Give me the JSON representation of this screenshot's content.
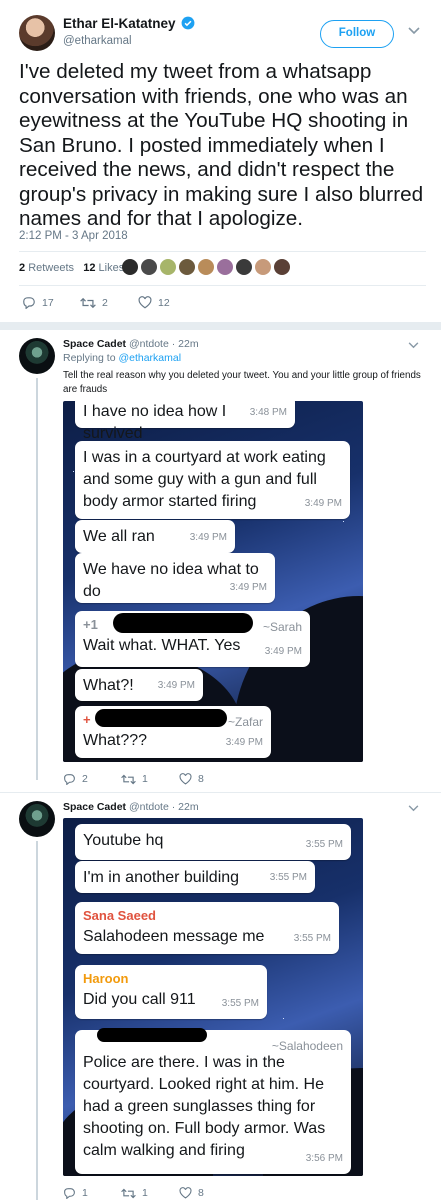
{
  "main_tweet": {
    "author_name": "Ethar El-Katatney",
    "author_handle": "@etharkamal",
    "follow_label": "Follow",
    "text": "I've deleted my tweet from a whatsapp conversation with friends, one who was an eyewitness at the YouTube HQ shooting in San Bruno. I posted immediately when I received the news, and didn't respect the group's privacy in making sure I also blurred names and for that I apologize.",
    "timestamp": "2:12 PM - 3 Apr 2018",
    "retweets_count": "2",
    "retweets_label": "Retweets",
    "likes_count": "12",
    "likes_label": "Likes",
    "replies": "17",
    "retweets": "2",
    "likes": "12"
  },
  "reply1": {
    "name": "Space Cadet",
    "handle_time": "@ntdote · 22m",
    "replying_prefix": "Replying to",
    "replying_to": "@etharkamal",
    "text": "Tell the real reason why you deleted your tweet. You and your little group of friends are frauds",
    "replies": "2",
    "retweets": "1",
    "likes": "8",
    "messages": [
      {
        "text": "I have no idea how I survived",
        "time": "3:48 PM"
      },
      {
        "text": "I was in a courtyard at work eating and some guy with a gun and full body armor started firing",
        "time": "3:49 PM"
      },
      {
        "text": "We all ran",
        "time": "3:49 PM"
      },
      {
        "text": "We have no idea what to do",
        "time": "3:49 PM"
      },
      {
        "sender_prefix": "+1",
        "nick": "~Sarah",
        "text": "Wait what. WHAT. Yes",
        "time": "3:49 PM"
      },
      {
        "text": "What?!",
        "time": "3:49 PM"
      },
      {
        "sender_prefix": "+",
        "nick": "~Zafar",
        "text": "What???",
        "time": "3:49 PM"
      }
    ]
  },
  "reply2": {
    "name": "Space Cadet",
    "handle_time": "@ntdote · 22m",
    "replies": "1",
    "retweets": "1",
    "likes": "8",
    "messages": [
      {
        "text": "Youtube hq",
        "time": "3:55 PM"
      },
      {
        "text": "I'm in another building",
        "time": "3:55 PM"
      },
      {
        "sender": "Sana Saeed",
        "sender_color": "#e0533f",
        "text": "Salahodeen message me",
        "time": "3:55 PM"
      },
      {
        "sender": "Haroon",
        "sender_color": "#f29a0c",
        "text": "Did you call 911",
        "time": "3:55 PM"
      },
      {
        "nick": "~Salahodeen",
        "text": "Police are there. I was in the courtyard. Looked right at him. He had a green sunglasses thing for shooting on. Full body armor. Was calm walking and firing",
        "time": "3:56 PM"
      }
    ]
  },
  "colors": {
    "accent": "#1da1f2",
    "text": "#14171a",
    "muted": "#657786"
  }
}
